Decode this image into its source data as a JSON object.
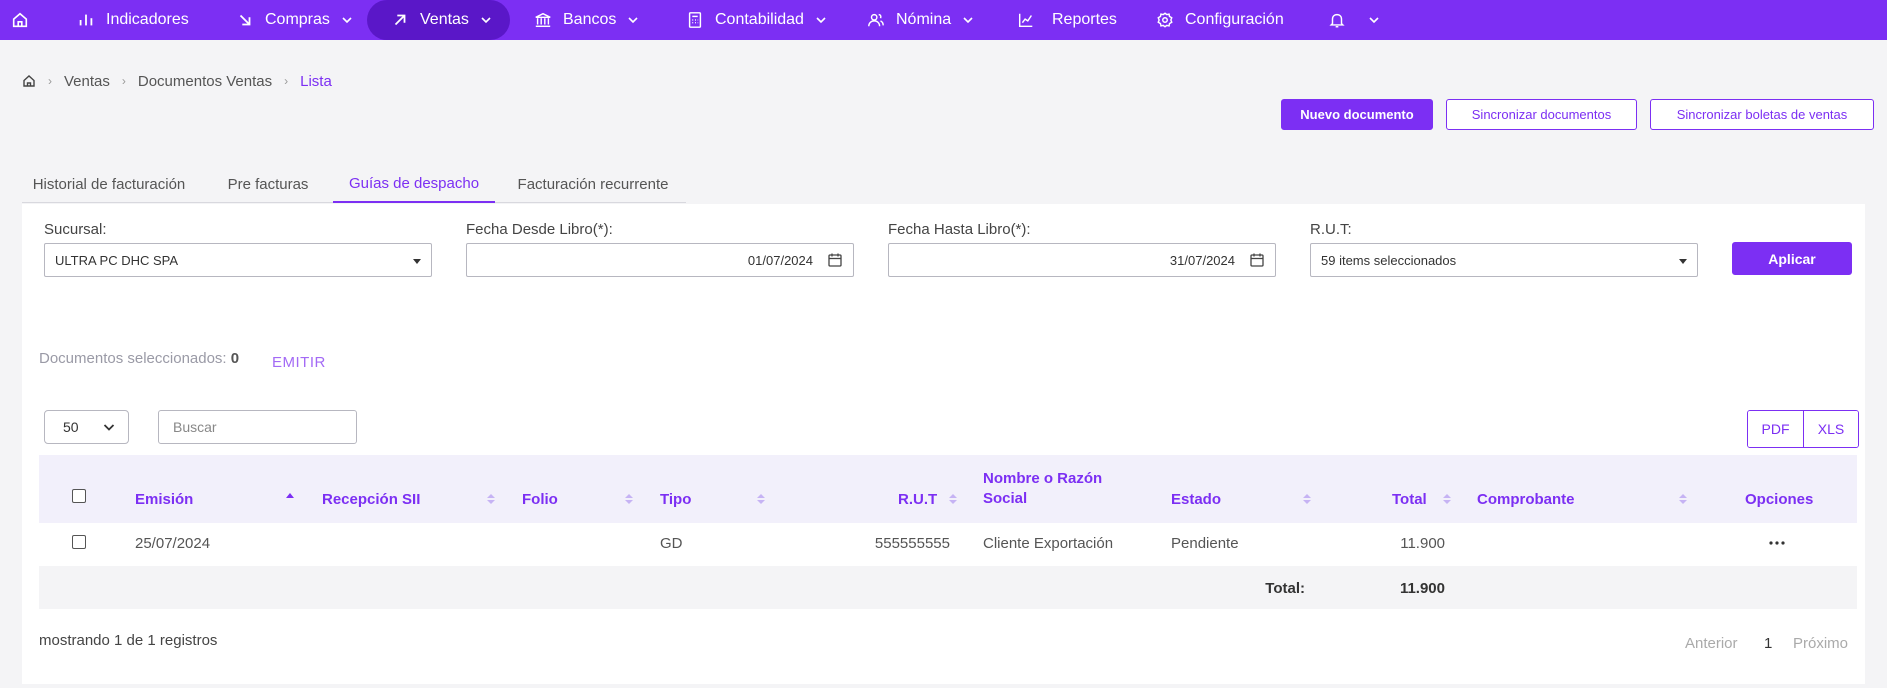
{
  "nav": {
    "items": [
      {
        "label": "Indicadores",
        "icon": "bar-chart-icon"
      },
      {
        "label": "Compras",
        "icon": "arrow-down-right-icon"
      },
      {
        "label": "Ventas",
        "icon": "arrow-up-right-icon"
      },
      {
        "label": "Bancos",
        "icon": "bank-icon"
      },
      {
        "label": "Contabilidad",
        "icon": "calculator-icon"
      },
      {
        "label": "Nómina",
        "icon": "users-icon"
      },
      {
        "label": "Reportes",
        "icon": "line-chart-icon"
      },
      {
        "label": "Configuración",
        "icon": "gear-icon"
      }
    ],
    "accent": "#7c2ff3",
    "active_bg": "#5a17c8"
  },
  "breadcrumb": {
    "items": [
      "Ventas",
      "Documentos Ventas"
    ],
    "current": "Lista"
  },
  "actions": {
    "new_doc": "Nuevo documento",
    "sync_docs": "Sincronizar documentos",
    "sync_boletas": "Sincronizar boletas de ventas"
  },
  "tabs": [
    "Historial de facturación",
    "Pre facturas",
    "Guías de despacho",
    "Facturación recurrente"
  ],
  "filters": {
    "sucursal_label": "Sucursal:",
    "sucursal_value": "ULTRA PC DHC SPA",
    "desde_label": "Fecha Desde Libro(*):",
    "desde_value": "01/07/2024",
    "hasta_label": "Fecha Hasta Libro(*):",
    "hasta_value": "31/07/2024",
    "rut_label": "R.U.T:",
    "rut_value": "59 items seleccionados",
    "apply": "Aplicar"
  },
  "selection": {
    "label": "Documentos seleccionados:",
    "count": "0",
    "emit": "EMITIR"
  },
  "table_controls": {
    "page_size": "50",
    "search_placeholder": "Buscar",
    "pdf": "PDF",
    "xls": "XLS"
  },
  "table": {
    "headers": {
      "emision": "Emisión",
      "recepcion": "Recepción SII",
      "folio": "Folio",
      "tipo": "Tipo",
      "rut": "R.U.T",
      "nombre1": "Nombre o Razón",
      "nombre2": "Social",
      "estado": "Estado",
      "total": "Total",
      "comprobante": "Comprobante",
      "opciones": "Opciones"
    },
    "rows": [
      {
        "emision": "25/07/2024",
        "recepcion": "",
        "folio": "",
        "tipo": "GD",
        "rut": "555555555",
        "nombre": "Cliente Exportación",
        "estado": "Pendiente",
        "total": "11.900",
        "comprobante": ""
      }
    ],
    "footer_label": "Total:",
    "footer_total": "11.900"
  },
  "pagination": {
    "showing": "mostrando 1 de 1 registros",
    "prev": "Anterior",
    "page": "1",
    "next": "Próximo"
  }
}
